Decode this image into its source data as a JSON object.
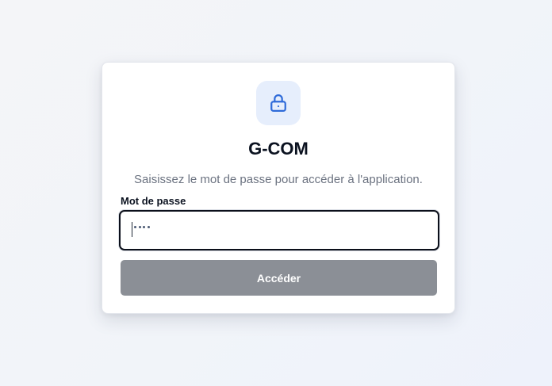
{
  "app": {
    "title": "G-COM",
    "subtitle": "Saisissez le mot de passe pour accéder à l'application."
  },
  "lock_icon": "lock-icon",
  "password": {
    "label": "Mot de passe",
    "masked_value": "••••",
    "masked_length": 4
  },
  "submit": {
    "label": "Accéder",
    "disabled": true
  },
  "colors": {
    "accent": "#2f6bd9",
    "icon_background": "#e6eefc",
    "button_disabled": "#8b8f96",
    "title_text": "#0b1220",
    "muted_text": "#6b7280"
  }
}
